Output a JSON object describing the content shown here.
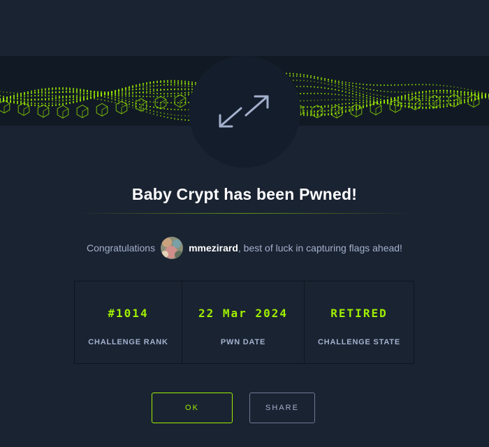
{
  "badge": {
    "icon": "expand-arrows-icon"
  },
  "title": "Baby Crypt has been Pwned!",
  "congrats": {
    "lead": "Congratulations",
    "username": "mmezirard",
    "trail": ", best of luck in capturing flags ahead!"
  },
  "stats": [
    {
      "value": "#1014",
      "label": "CHALLENGE RANK"
    },
    {
      "value": "22 Mar 2024",
      "label": "PWN DATE"
    },
    {
      "value": "RETIRED",
      "label": "CHALLENGE STATE"
    }
  ],
  "buttons": {
    "ok": "OK",
    "share": "SHARE"
  },
  "colors": {
    "accent": "#9fef00",
    "background": "#1a2332",
    "badge": "#141d2b"
  }
}
